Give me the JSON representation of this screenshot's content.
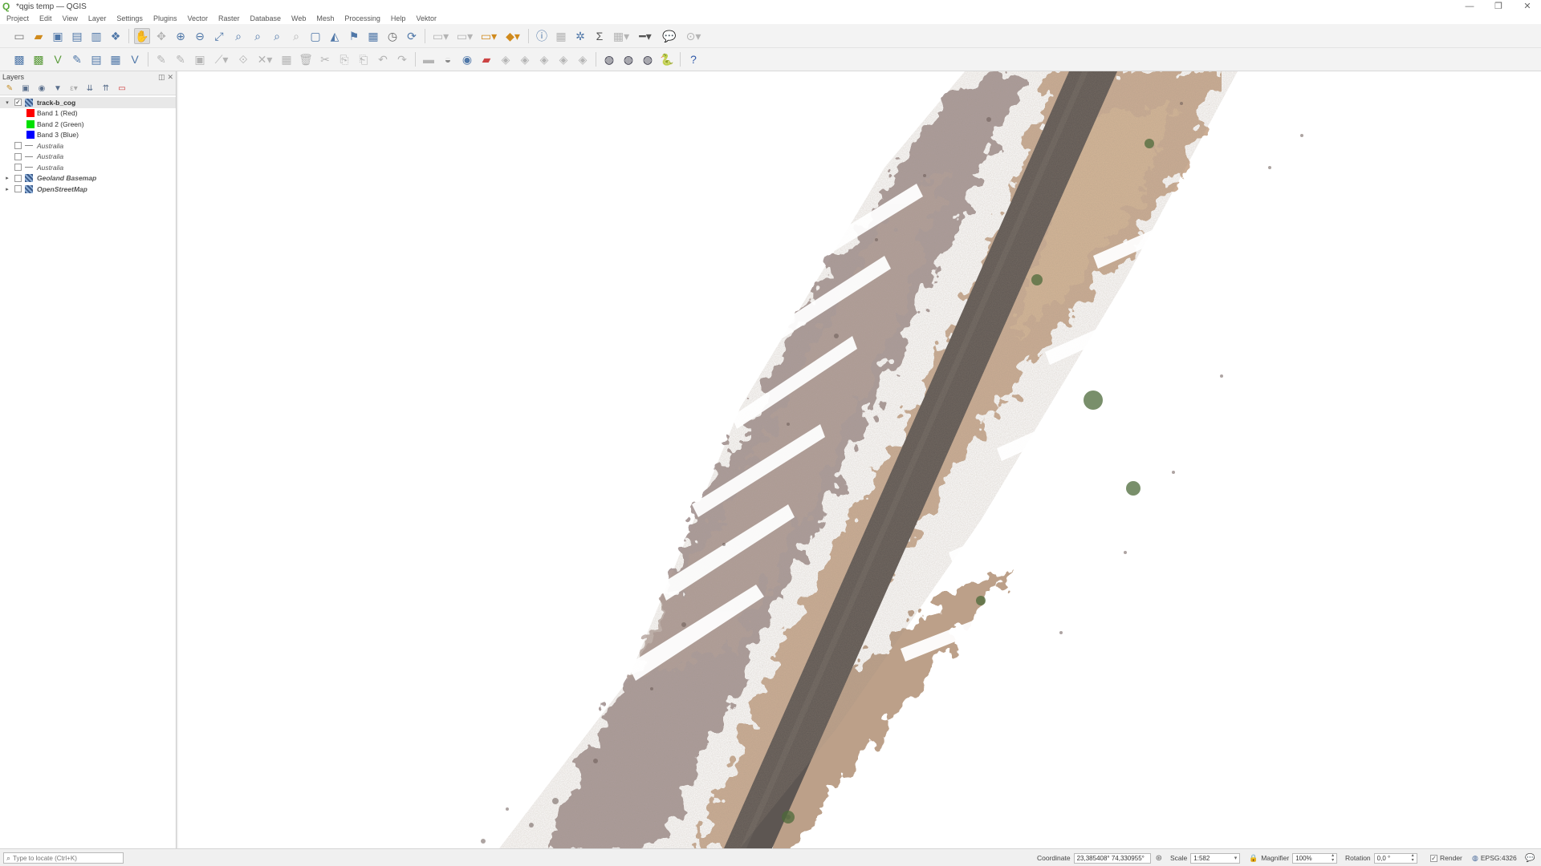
{
  "window": {
    "title": "*qgis temp — QGIS",
    "minimize": "—",
    "restore": "❐",
    "close": "✕"
  },
  "menu": [
    "Project",
    "Edit",
    "View",
    "Layer",
    "Settings",
    "Plugins",
    "Vector",
    "Raster",
    "Database",
    "Web",
    "Mesh",
    "Processing",
    "Help",
    "Vektor"
  ],
  "layers_panel": {
    "title": "Layers",
    "float_btn": "◫",
    "close_btn": "✕",
    "layers": [
      {
        "name": "track-b_cog",
        "checked": "✓",
        "expander": "▾"
      },
      {
        "band": "Band 1 (Red)",
        "color": "#ff0000"
      },
      {
        "band": "Band 2 (Green)",
        "color": "#00e000"
      },
      {
        "band": "Band 3 (Blue)",
        "color": "#0000ff"
      },
      {
        "name": "Australia"
      },
      {
        "name": "Australia"
      },
      {
        "name": "Australia"
      },
      {
        "name": "Geoland Basemap",
        "expander": "▸"
      },
      {
        "name": "OpenStreetMap",
        "expander": "▸"
      }
    ]
  },
  "status": {
    "locate_placeholder": "Type to locate (Ctrl+K)",
    "coordinate_label": "Coordinate",
    "coordinate_value": "23,385408° 74,330955°",
    "scale_label": "Scale",
    "scale_value": "1:582",
    "magnifier_label": "Magnifier",
    "magnifier_value": "100%",
    "rotation_label": "Rotation",
    "rotation_value": "0,0 °",
    "render_label": "Render",
    "render_checked": "✓",
    "crs": "EPSG:4326"
  },
  "colors": {
    "road": "#5e5753",
    "soil": "#c7a98c",
    "soil_dark": "#a28570",
    "field_left": "#9a8a88",
    "vegetation": "#4c6a3a"
  }
}
